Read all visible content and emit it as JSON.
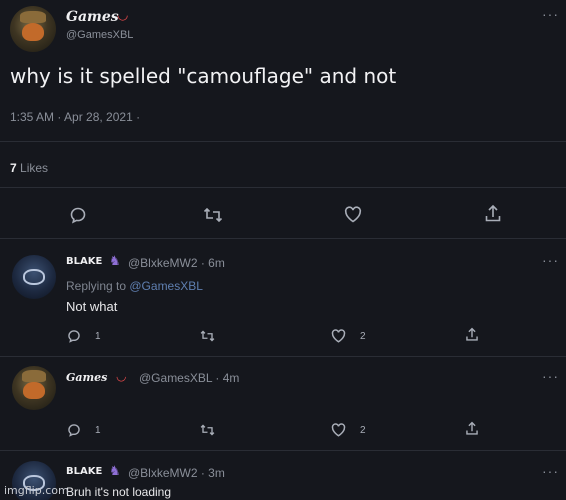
{
  "tweet": {
    "author_name": "Games",
    "author_handle": "@GamesXBL",
    "text": "why is it spelled \"camouflage\" and not",
    "meta": "1:35 AM · Apr 28, 2021 ·",
    "likes_count": "7",
    "likes_label": "Likes"
  },
  "replies": [
    {
      "author_name": "BLAKE",
      "author_handle": "@BlxkeMW2 · 6m",
      "replying_prefix": "Replying to ",
      "replying_handle": "@GamesXBL",
      "text": "Not what",
      "reply_count": "1",
      "like_count": "2"
    },
    {
      "author_name": "Games",
      "author_handle": "@GamesXBL · 4m",
      "reply_count": "1",
      "like_count": "2"
    },
    {
      "author_name": "BLAKE",
      "author_handle": "@BlxkeMW2 · 3m",
      "text": "Bruh it's not loading"
    }
  ],
  "watermark": "imgflip.com",
  "icons": {
    "reply": "reply-icon",
    "retweet": "retweet-icon",
    "like": "heart-icon",
    "share": "share-icon",
    "more": "more-icon"
  },
  "colors": {
    "background": "#15171d",
    "accent_link": "#5f7fb0",
    "emoji_red": "#e5494b"
  }
}
